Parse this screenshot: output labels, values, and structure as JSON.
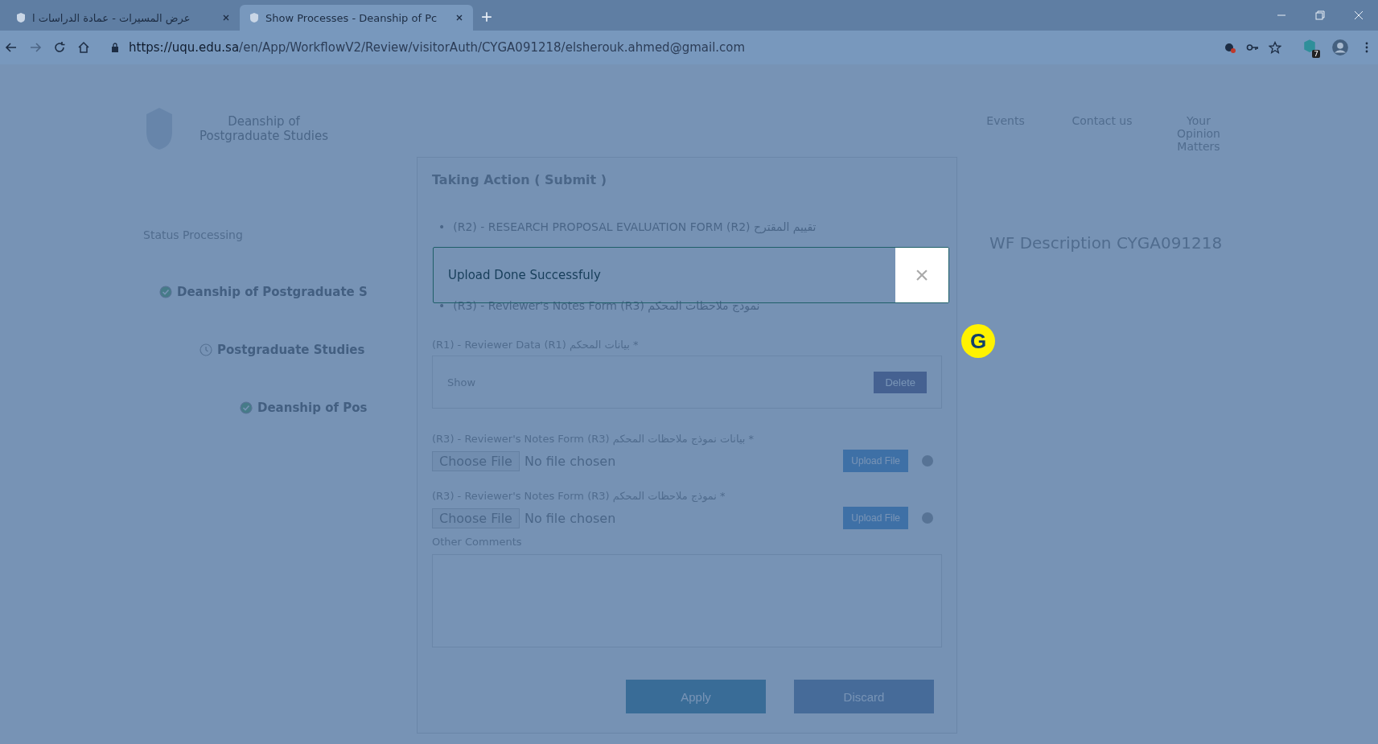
{
  "browser": {
    "tabs": [
      {
        "title": "عرض المسيرات - عمادة الدراسات ا",
        "selected": false
      },
      {
        "title": "Show Processes - Deanship of Pc",
        "selected": true
      }
    ],
    "url_host": "https://uqu.edu.sa",
    "url_path": "/en/App/WorkflowV2/Review/visitorAuth/CYGA091218/elsherouk.ahmed@gmail.com",
    "extension_badge": "7"
  },
  "page": {
    "site_title": "Deanship of Postgraduate Studies",
    "nav": [
      {
        "label": "Events"
      },
      {
        "label": "Contact us"
      },
      {
        "label": "Your Opinion Matters"
      }
    ],
    "status": "Status Processing",
    "steps": [
      {
        "title": "Deanship of Postgraduate S",
        "done": true
      },
      {
        "title": "Postgraduate Studies",
        "done": false
      },
      {
        "title": "Deanship of Pos",
        "done": true
      }
    ],
    "wf_description": "WF Description CYGA091218"
  },
  "modal": {
    "title": "Taking Action ( Submit )",
    "bullet_marker": "•",
    "bullets": [
      "(R2) - RESEARCH PROPOSAL EVALUATION FORM (R2) تقييم المقترح",
      "(R3) - Reviewer's Notes Form (R3) نموذج ملاحظات المحكم"
    ],
    "fields": [
      {
        "kind": "attached",
        "label": "(R1) - Reviewer Data (R1) بيانات المحكم *",
        "show": "Show",
        "delete": "Delete"
      },
      {
        "kind": "file",
        "label": "(R3) - Reviewer's Notes Form (R3) بيانات نموذج ملاحظات المحكم *",
        "choose": "Choose File",
        "chosen": "No file chosen",
        "upload": "Upload File"
      },
      {
        "kind": "file",
        "label": "(R3) - Reviewer's Notes Form (R3) نموذج ملاحظات المحكم *",
        "choose": "Choose File",
        "chosen": "No file chosen",
        "upload": "Upload File"
      }
    ],
    "comments_label": "Other Comments",
    "buttons": [
      {
        "label": "Apply",
        "kind": "primary"
      },
      {
        "label": "Discard",
        "kind": "secondary"
      }
    ]
  },
  "toast": {
    "message": "Upload Done Successfuly",
    "close": "×"
  },
  "badge": "G"
}
